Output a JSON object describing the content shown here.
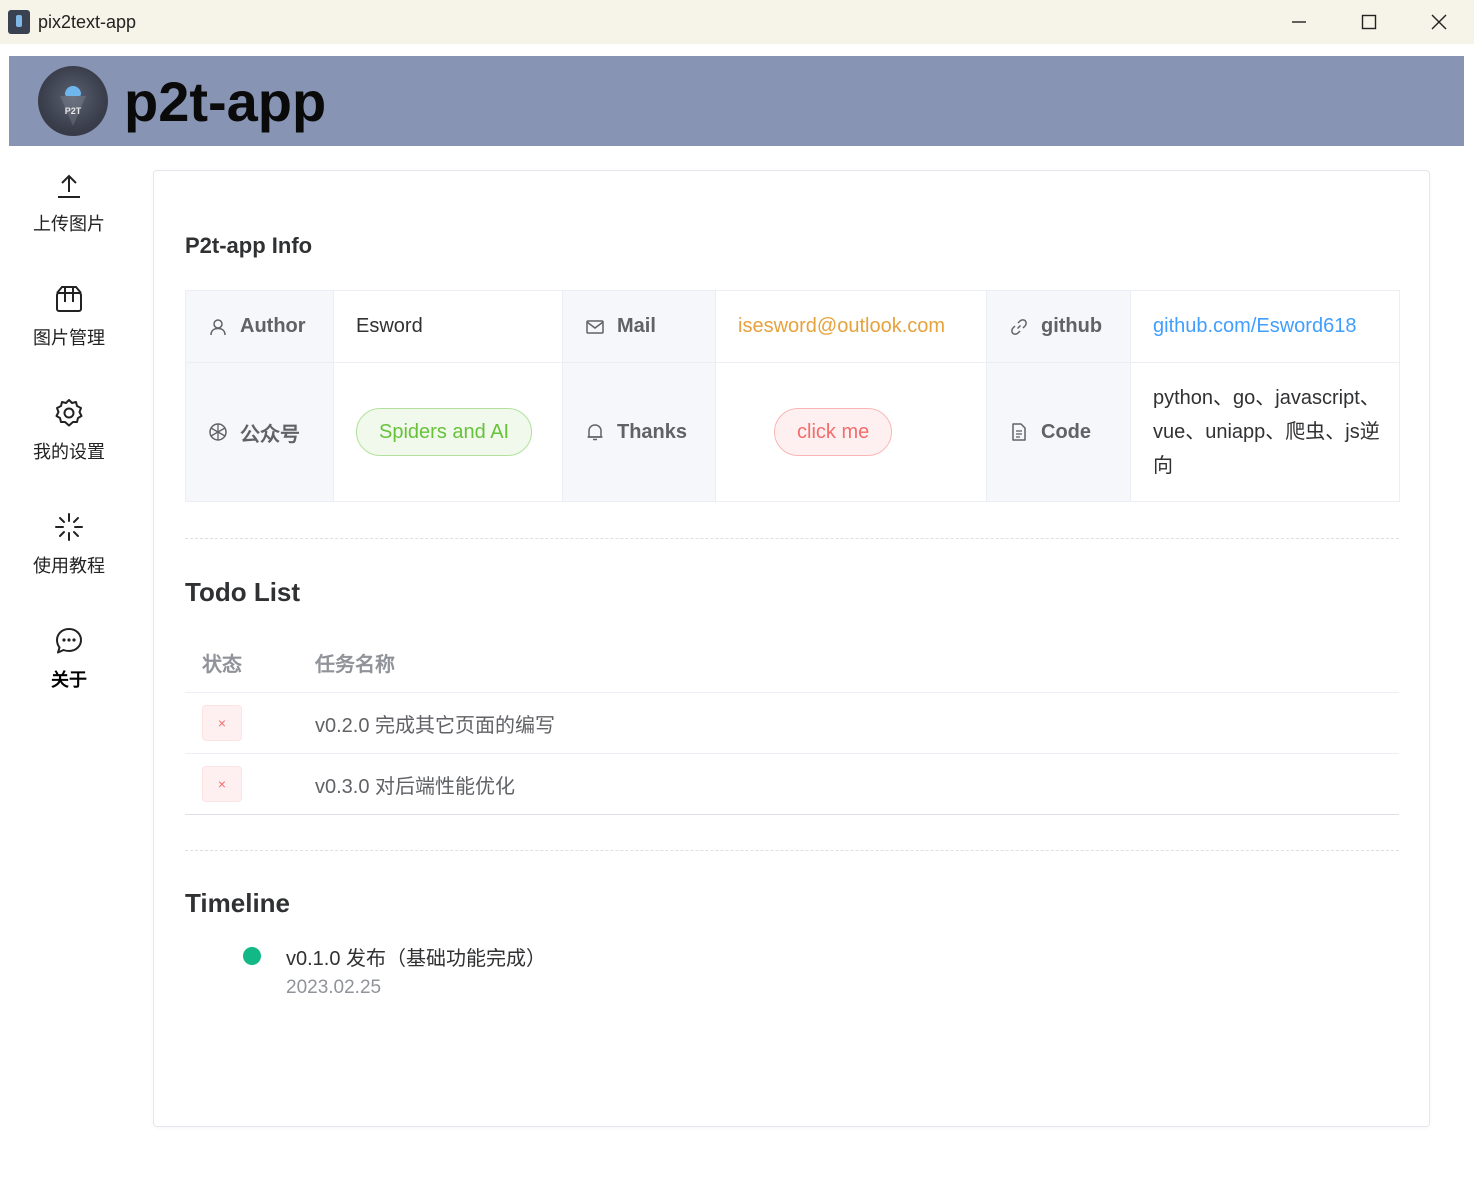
{
  "window": {
    "title": "pix2text-app"
  },
  "header": {
    "title": "p2t-app",
    "logo_text": "P2T"
  },
  "sidebar": {
    "items": [
      {
        "label": "上传图片",
        "icon": "upload-icon"
      },
      {
        "label": "图片管理",
        "icon": "box-icon"
      },
      {
        "label": "我的设置",
        "icon": "gear-icon"
      },
      {
        "label": "使用教程",
        "icon": "loading-icon"
      },
      {
        "label": "关于",
        "icon": "chat-icon",
        "active": true
      }
    ]
  },
  "info": {
    "title": "P2t-app Info",
    "author_label": "Author",
    "author_value": "Esword",
    "mail_label": "Mail",
    "mail_value": "isesword@outlook.com",
    "github_label": "github",
    "github_value": "github.com/Esword618",
    "wechat_label": "公众号",
    "wechat_value": "Spiders and AI",
    "thanks_label": "Thanks",
    "thanks_value": "click me",
    "code_label": "Code",
    "code_value": "python、go、javascript、vue、uniapp、爬虫、js逆向"
  },
  "todo": {
    "title": "Todo List",
    "columns": [
      "状态",
      "任务名称"
    ],
    "rows": [
      {
        "status": "×",
        "name": "v0.2.0 完成其它页面的编写"
      },
      {
        "status": "×",
        "name": "v0.3.0 对后端性能优化"
      }
    ]
  },
  "timeline": {
    "title": "Timeline",
    "items": [
      {
        "content": "v0.1.0 发布（基础功能完成）",
        "timestamp": "2023.02.25",
        "color": "#12b886"
      }
    ]
  },
  "colors": {
    "header_bg": "#8894b4",
    "titlebar_bg": "#f6f3e8",
    "mail": "#e6a23c",
    "link": "#409eff",
    "success": "#67c23a",
    "danger": "#f56c6c"
  }
}
